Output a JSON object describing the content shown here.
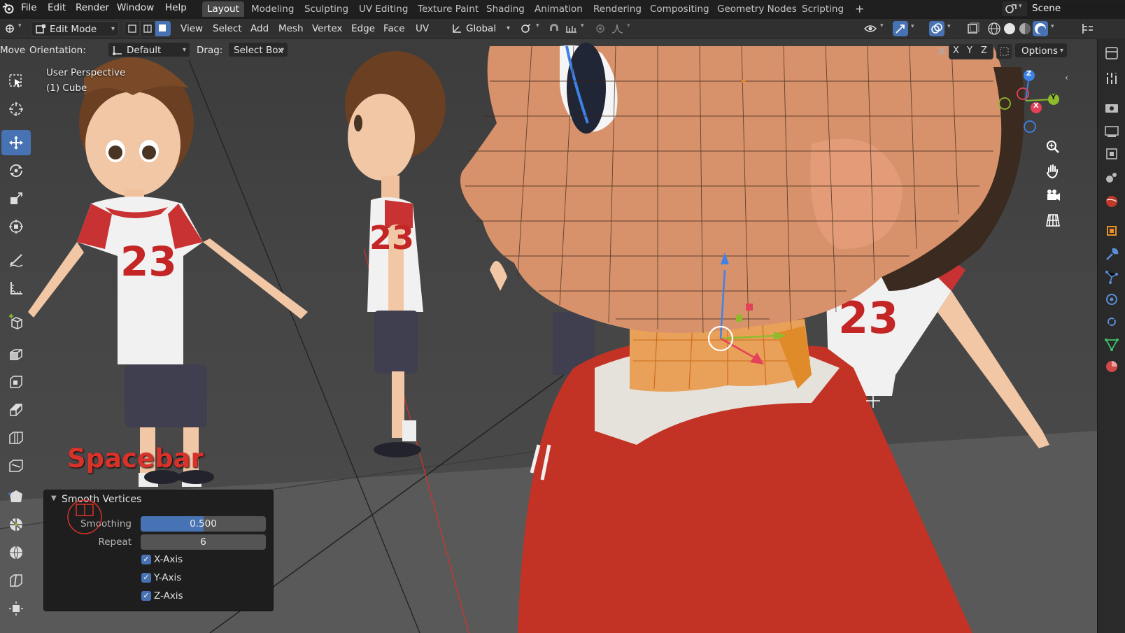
{
  "menubar": {
    "items": [
      "File",
      "Edit",
      "Render",
      "Window",
      "Help"
    ],
    "workspaces": [
      "Layout",
      "Modeling",
      "Sculpting",
      "UV Editing",
      "Texture Paint",
      "Shading",
      "Animation",
      "Rendering",
      "Compositing",
      "Geometry Nodes",
      "Scripting"
    ],
    "active_workspace": "Layout",
    "add_tab": "+",
    "scene_name": "Scene"
  },
  "header": {
    "mode": "Edit Mode",
    "menus": [
      "View",
      "Select",
      "Add",
      "Mesh",
      "Vertex",
      "Edge",
      "Face",
      "UV"
    ],
    "transform_orientation": "Global"
  },
  "toolsettings": {
    "tool_name": "Move",
    "orientation_label": "Orientation:",
    "orientation_value": "Default",
    "drag_label": "Drag:",
    "drag_value": "Select Box",
    "axes": [
      "X",
      "Y",
      "Z"
    ],
    "options": "Options"
  },
  "viewport": {
    "perspective": "User Perspective",
    "object": "(1) Cube",
    "overlay_text": "Spacebar",
    "jersey_number": "23",
    "gizmo_axes": {
      "x": "X",
      "y": "Y",
      "z": "Z"
    },
    "colors": {
      "x": "#e3425a",
      "y": "#8dbb2c",
      "z": "#3f82e6",
      "active": "#4772b3",
      "overlay_red": "#d8322a"
    }
  },
  "operator_panel": {
    "title": "Smooth Vertices",
    "smoothing_label": "Smoothing",
    "smoothing_value": "0.500",
    "smoothing_fraction": 0.5,
    "repeat_label": "Repeat",
    "repeat_value": "6",
    "x_axis": "X-Axis",
    "y_axis": "Y-Axis",
    "z_axis": "Z-Axis",
    "checked": [
      true,
      true,
      true
    ]
  }
}
